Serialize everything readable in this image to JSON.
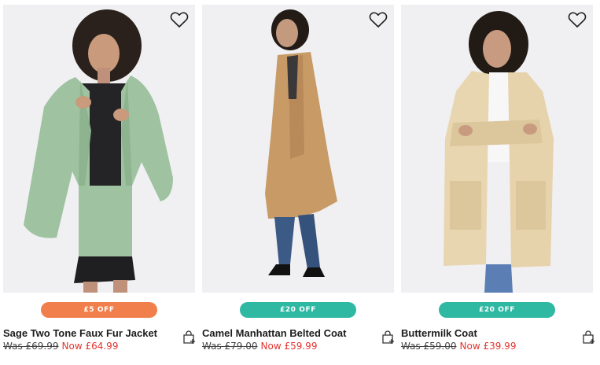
{
  "products": [
    {
      "name": "Sage Two Tone Faux Fur Jacket",
      "badge": "£5 OFF",
      "badge_color": "#f07f4b",
      "was_price": "Was £69.99",
      "now_price": "Now £64.99"
    },
    {
      "name": "Camel Manhattan Belted Coat",
      "badge": "£20 OFF",
      "badge_color": "#2fb8a2",
      "was_price": "Was £79.00",
      "now_price": "Now £59.99"
    },
    {
      "name": "Buttermilk Coat",
      "badge": "£20 OFF",
      "badge_color": "#2fb8a2",
      "was_price": "Was £59.00",
      "now_price": "Now £39.99"
    }
  ],
  "icons": {
    "wishlist": "heart-outline-icon",
    "add_to_bag": "shopping-bag-plus-icon"
  },
  "colors": {
    "sale_price": "#e3342f",
    "photo_background": "#efeef0"
  }
}
